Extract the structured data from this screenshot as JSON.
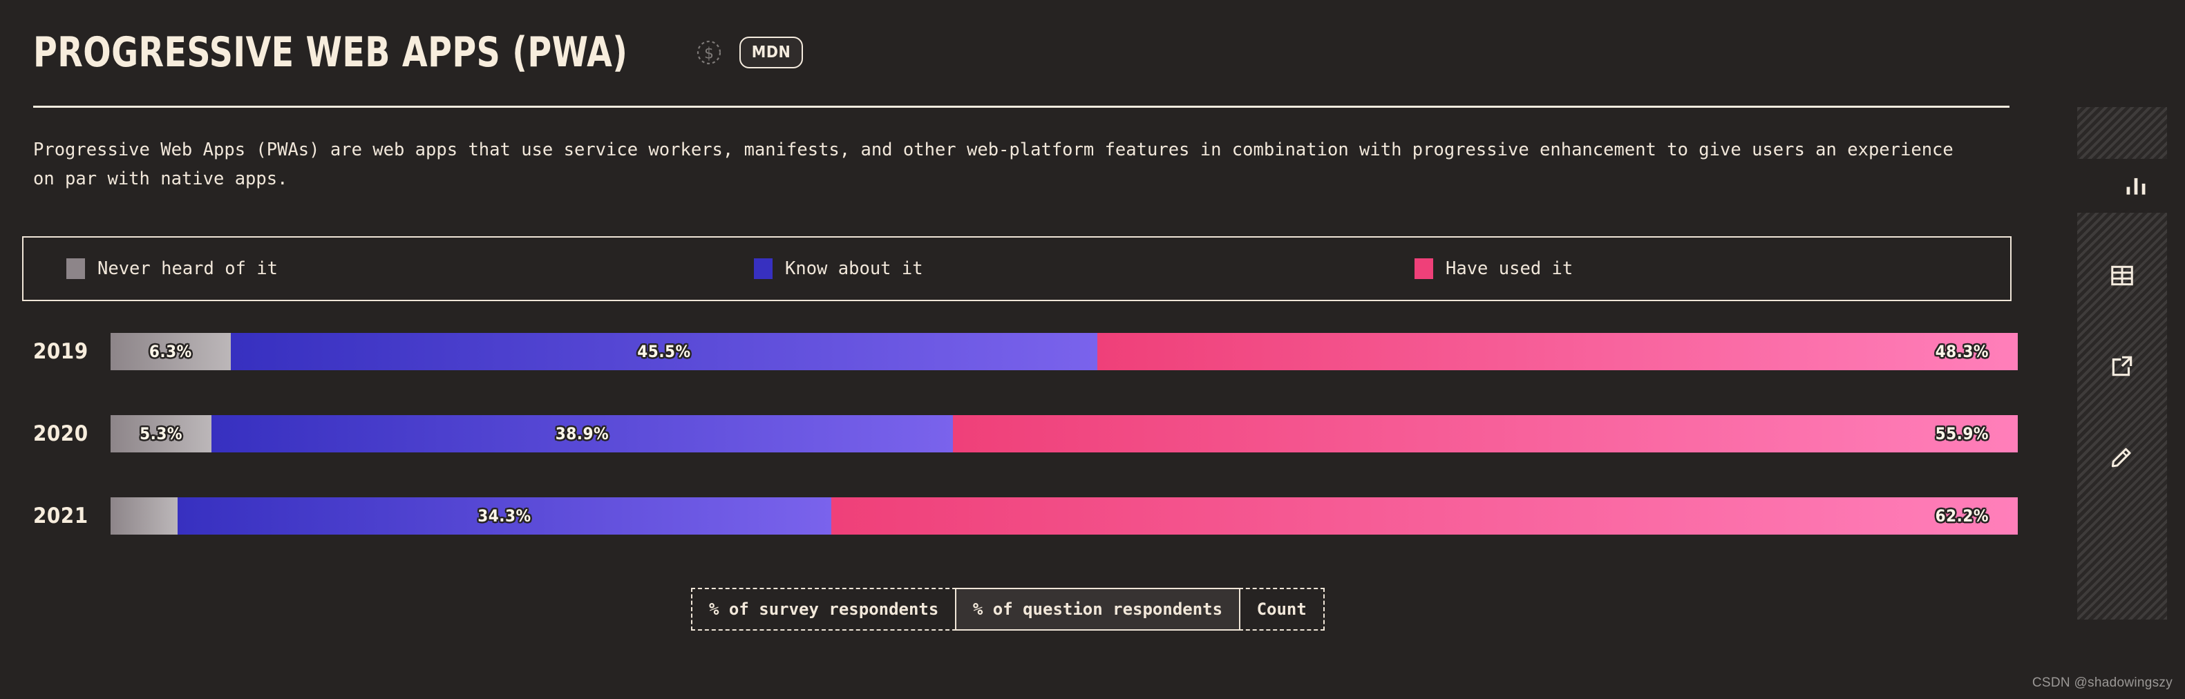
{
  "header": {
    "title": "Progressive Web Apps (PWA)",
    "sponsor_icon": "dollar-circle-icon",
    "mdn_label": "MDN"
  },
  "description": "Progressive Web Apps (PWAs) are web apps that use service workers, manifests, and other web-platform features in combination with progressive enhancement to give users an experience on par with native apps.",
  "legend": {
    "items": [
      {
        "label": "Never heard of it",
        "color": "#8d8589"
      },
      {
        "label": "Know about it",
        "color": "#3730c0"
      },
      {
        "label": "Have used it",
        "color": "#ef4079"
      }
    ]
  },
  "chart_data": {
    "type": "bar",
    "orientation": "horizontal",
    "stacked": true,
    "normalized": true,
    "title": "Progressive Web Apps (PWA)",
    "xlabel": "",
    "ylabel": "",
    "unit": "%",
    "xlim": [
      0,
      100
    ],
    "grid": false,
    "legend_position": "top",
    "categories": [
      "2019",
      "2020",
      "2021"
    ],
    "series": [
      {
        "name": "Never heard of it",
        "color": "#8d8589",
        "values": [
          6.3,
          5.3,
          3.5
        ]
      },
      {
        "name": "Know about it",
        "color": "#3730c0",
        "values": [
          45.5,
          38.9,
          34.3
        ]
      },
      {
        "name": "Have used it",
        "color": "#ef4079",
        "values": [
          48.3,
          55.9,
          62.2
        ]
      }
    ],
    "value_labels": [
      [
        "6.3%",
        "45.5%",
        "48.3%"
      ],
      [
        "5.3%",
        "38.9%",
        "55.9%"
      ],
      [
        "",
        "34.3%",
        "62.2%"
      ]
    ]
  },
  "rows": [
    {
      "year": "2019",
      "segments": [
        {
          "kind": "gray",
          "label": "6.3%",
          "width": 6.3,
          "align": "center",
          "show": true
        },
        {
          "kind": "blue",
          "label": "45.5%",
          "width": 45.5,
          "align": "center",
          "show": true
        },
        {
          "kind": "pink",
          "label": "48.3%",
          "width": 48.3,
          "align": "right",
          "show": true
        }
      ]
    },
    {
      "year": "2020",
      "segments": [
        {
          "kind": "gray",
          "label": "5.3%",
          "width": 5.3,
          "align": "center",
          "show": true
        },
        {
          "kind": "blue",
          "label": "38.9%",
          "width": 38.9,
          "align": "center",
          "show": true
        },
        {
          "kind": "pink",
          "label": "55.9%",
          "width": 55.9,
          "align": "right",
          "show": true
        }
      ]
    },
    {
      "year": "2021",
      "segments": [
        {
          "kind": "gray",
          "label": "",
          "width": 3.5,
          "align": "center",
          "show": false
        },
        {
          "kind": "blue",
          "label": "34.3%",
          "width": 34.3,
          "align": "center",
          "show": true
        },
        {
          "kind": "pink",
          "label": "62.2%",
          "width": 62.2,
          "align": "right",
          "show": true
        }
      ]
    }
  ],
  "tabs": [
    {
      "label": "% of survey respondents",
      "active": false
    },
    {
      "label": "% of question respondents",
      "active": true
    },
    {
      "label": "Count",
      "active": false
    }
  ],
  "sidebar": {
    "buttons": [
      {
        "icon": "bar-chart-icon",
        "active": true
      },
      {
        "icon": "table-grid-icon",
        "active": false
      },
      {
        "icon": "external-link-icon",
        "active": false
      },
      {
        "icon": "pencil-edit-icon",
        "active": false
      }
    ]
  },
  "watermark": "CSDN @shadowingszy",
  "colors": {
    "background": "#262322",
    "foreground": "#f5ecdf",
    "gray_start": "#8d8589",
    "gray_end": "#bcb7b9",
    "blue_start": "#3730c0",
    "blue_end": "#7a63ec",
    "pink_start": "#ef4079",
    "pink_end": "#ff7fba"
  }
}
